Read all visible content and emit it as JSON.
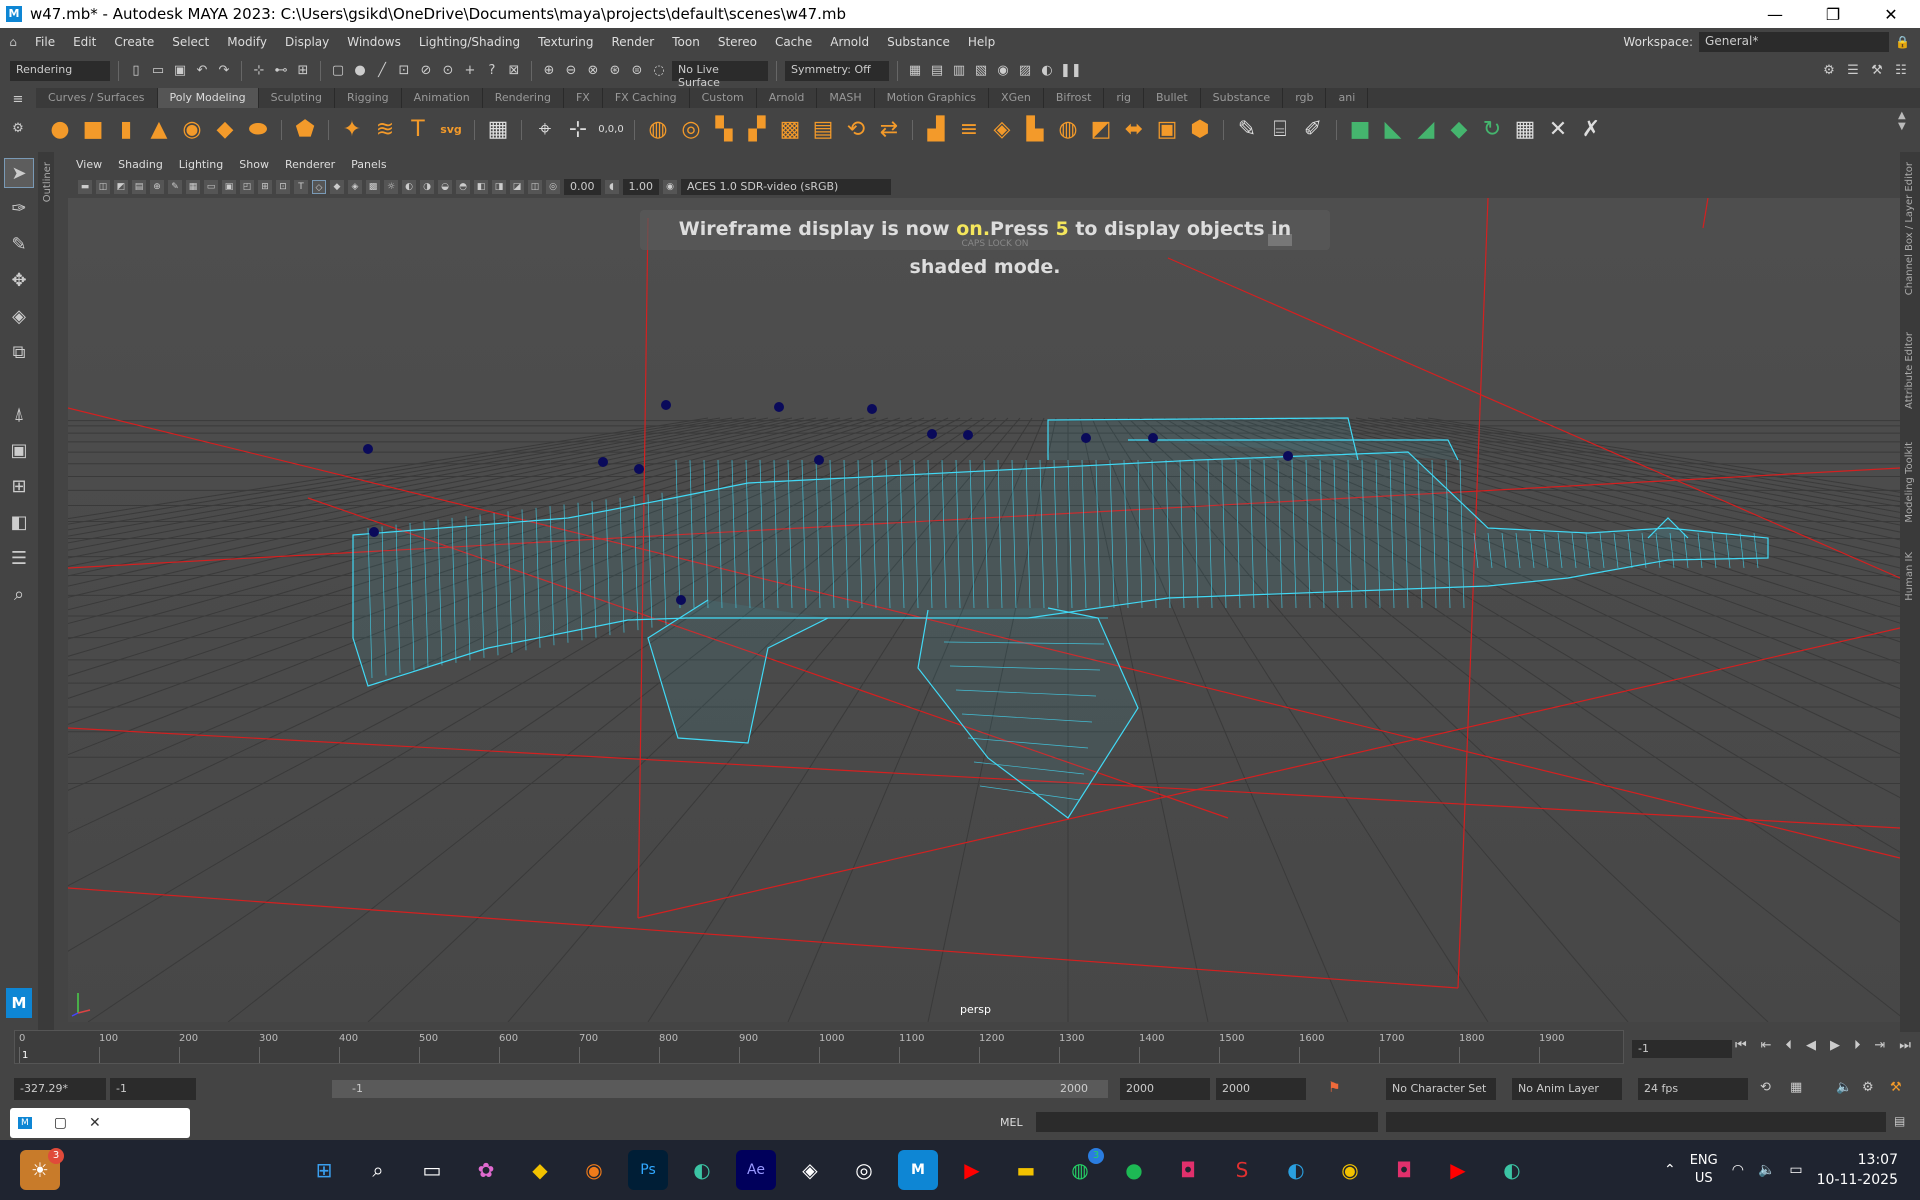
{
  "window": {
    "title": "w47.mb* - Autodesk MAYA 2023: C:\\Users\\gsikd\\OneDrive\\Documents\\maya\\projects\\default\\scenes\\w47.mb",
    "app_icon": "M"
  },
  "menubar": {
    "items": [
      "File",
      "Edit",
      "Create",
      "Select",
      "Modify",
      "Display",
      "Windows",
      "Lighting/Shading",
      "Texturing",
      "Render",
      "Toon",
      "Stereo",
      "Cache",
      "Arnold",
      "Substance",
      "Help"
    ],
    "workspace_label": "Workspace:",
    "workspace_value": "General*"
  },
  "statusline": {
    "menuset": "Rendering",
    "live_surface": "No Live Surface",
    "symmetry": "Symmetry: Off"
  },
  "shelf": {
    "tabs": [
      "Curves / Surfaces",
      "Poly Modeling",
      "Sculpting",
      "Rigging",
      "Animation",
      "Rendering",
      "FX",
      "FX Caching",
      "Custom",
      "Arnold",
      "MASH",
      "Motion Graphics",
      "XGen",
      "Bifrost",
      "rig",
      "Bullet",
      "Substance",
      "rgb",
      "ani"
    ],
    "active_tab": "Poly Modeling",
    "svg_label": "svg"
  },
  "panel": {
    "menus": [
      "View",
      "Shading",
      "Lighting",
      "Show",
      "Renderer",
      "Panels"
    ],
    "exposure": "0.00",
    "gamma": "1.00",
    "colorspace": "ACES 1.0 SDR-video (sRGB)",
    "coord_readout": "0,0,0"
  },
  "viewport": {
    "hud_prefix": "Wireframe display is now ",
    "hud_on": "on.",
    "hud_press": "Press ",
    "hud_key": "5",
    "hud_suffix": " to display objects in shaded mode.",
    "caps_lock": "CAPS LOCK ON",
    "camera": "persp"
  },
  "side_tabs": [
    "Outliner",
    "Channel Box / Layer Editor",
    "Attribute Editor",
    "Modeling Toolkit",
    "Human IK"
  ],
  "timeline": {
    "ticks": [
      "0",
      "100",
      "200",
      "300",
      "400",
      "500",
      "600",
      "700",
      "800",
      "900",
      "1000",
      "1100",
      "1200",
      "1300",
      "1400",
      "1500",
      "1600",
      "1700",
      "1800",
      "1900"
    ],
    "current_marker": "1",
    "current_frame": "-1"
  },
  "range": {
    "time_readout": "-327.29*",
    "start": "-1",
    "inner_start": "-1",
    "inner_end": "2000",
    "end1": "2000",
    "end2": "2000",
    "character_set": "No Character Set",
    "anim_layer": "No Anim Layer",
    "fps": "24 fps"
  },
  "command": {
    "label": "MEL"
  },
  "taskbar": {
    "notification_count": "3",
    "whatsapp_count": "3",
    "lang1": "ENG",
    "lang2": "US",
    "time": "13:07",
    "date": "10-11-2025"
  },
  "colors": {
    "wireframe": "#41d9f5",
    "grid_red": "#d42020",
    "shelf_icon": "#f39a2a"
  }
}
